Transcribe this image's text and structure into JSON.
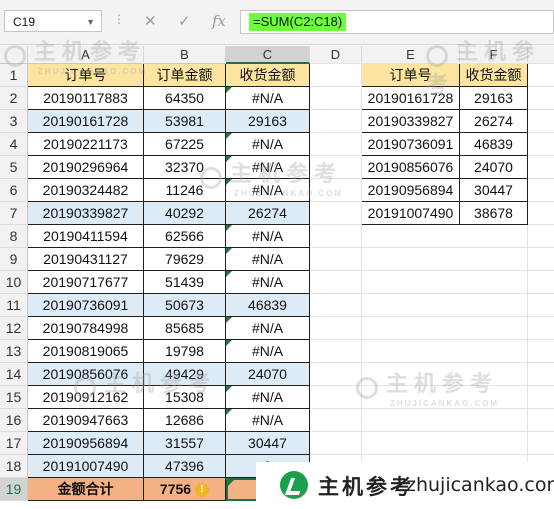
{
  "formula_bar": {
    "name_box": "C19",
    "cancel_icon": "✕",
    "enter_icon": "✓",
    "fx_icon": "fx",
    "formula": "=SUM(C2:C18)"
  },
  "columns": [
    "A",
    "B",
    "C",
    "D",
    "E",
    "F"
  ],
  "rows": [
    "1",
    "2",
    "3",
    "4",
    "5",
    "6",
    "7",
    "8",
    "9",
    "10",
    "11",
    "12",
    "13",
    "14",
    "15",
    "16",
    "17",
    "18",
    "19"
  ],
  "main_table": {
    "headers": [
      "订单号",
      "订单金额",
      "收货金额"
    ],
    "rows": [
      [
        "20190117883",
        "64350",
        "#N/A"
      ],
      [
        "20190161728",
        "53981",
        "29163"
      ],
      [
        "20190221173",
        "67225",
        "#N/A"
      ],
      [
        "20190296964",
        "32370",
        "#N/A"
      ],
      [
        "20190324482",
        "11246",
        "#N/A"
      ],
      [
        "20190339827",
        "40292",
        "26274"
      ],
      [
        "20190411594",
        "62566",
        "#N/A"
      ],
      [
        "20190431127",
        "79629",
        "#N/A"
      ],
      [
        "20190717677",
        "51439",
        "#N/A"
      ],
      [
        "20190736091",
        "50673",
        "46839"
      ],
      [
        "20190784998",
        "85685",
        "#N/A"
      ],
      [
        "20190819065",
        "19798",
        "#N/A"
      ],
      [
        "20190856076",
        "49429",
        "24070"
      ],
      [
        "20190912162",
        "15308",
        "#N/A"
      ],
      [
        "20190947663",
        "12686",
        "#N/A"
      ],
      [
        "20190956894",
        "31557",
        "30447"
      ],
      [
        "20191007490",
        "47396",
        "3"
      ]
    ],
    "total_label": "金额合计",
    "total_amount": "7756",
    "total_received": "#"
  },
  "side_table": {
    "headers": [
      "订单号",
      "收货金额"
    ],
    "rows": [
      [
        "20190161728",
        "29163"
      ],
      [
        "20190339827",
        "26274"
      ],
      [
        "20190736091",
        "46839"
      ],
      [
        "20190856076",
        "24070"
      ],
      [
        "20190956894",
        "30447"
      ],
      [
        "20191007490",
        "38678"
      ]
    ]
  },
  "watermark": {
    "name": "主机参考",
    "url": "ZHUJICANKAO.COM"
  },
  "banner": {
    "name": "主机参考",
    "url": "zhujicankao.com"
  },
  "colors": {
    "header_fill": "#fbe5a0",
    "highlight_fill": "#ddebf7",
    "total_fill": "#f4b183",
    "formula_highlight": "#6bff3e",
    "error_indicator": "#1b7a3b"
  }
}
